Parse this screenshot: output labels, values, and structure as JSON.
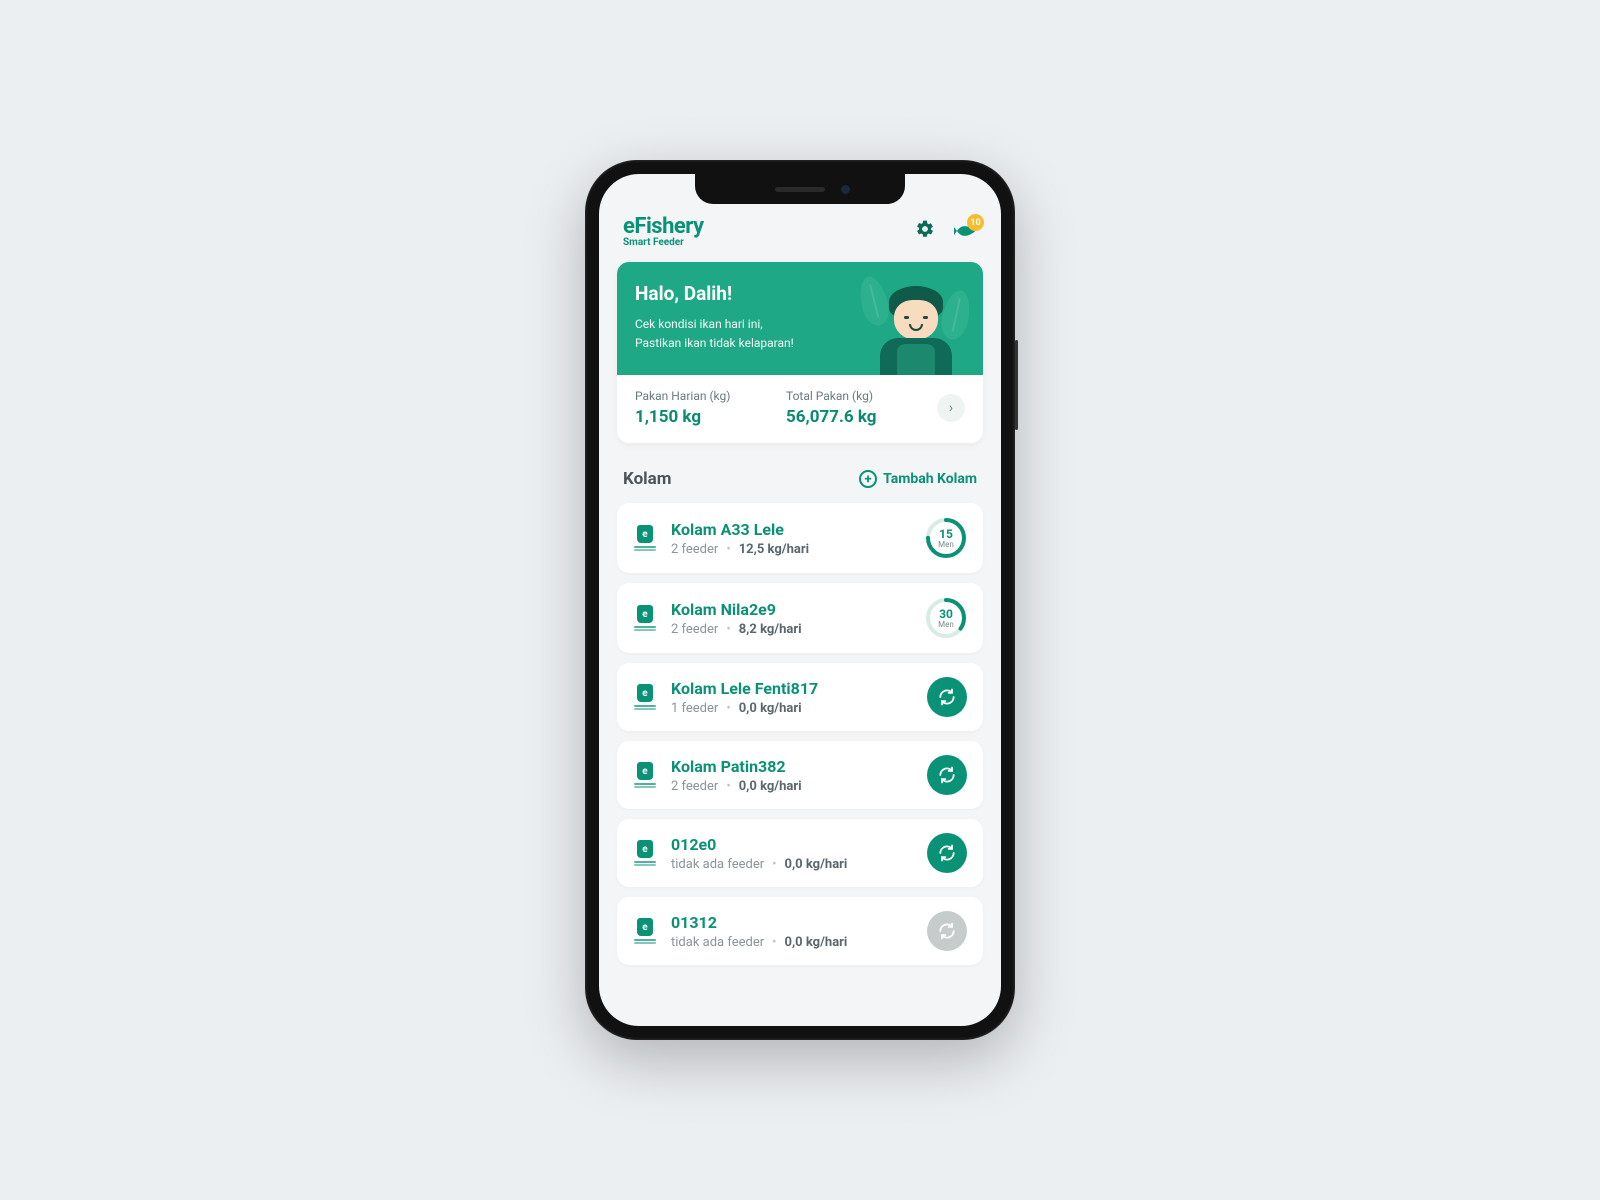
{
  "brand": {
    "name": "eFishery",
    "subtitle": "Smart Feeder"
  },
  "notifications": {
    "count": "10"
  },
  "hero": {
    "greeting": "Halo, Dalih!",
    "line1": "Cek kondisi ikan hari ini,",
    "line2": "Pastikan ikan tidak kelaparan!"
  },
  "stats": {
    "daily_label": "Pakan Harian (kg)",
    "daily_value": "1,150 kg",
    "total_label": "Total Pakan (kg)",
    "total_value": "56,077.6 kg"
  },
  "section": {
    "title": "Kolam",
    "add_label": "Tambah Kolam"
  },
  "ponds": [
    {
      "name": "Kolam A33 Lele",
      "feeder": "2 feeder",
      "rate": "12,5 kg/hari",
      "timer_value": "15",
      "timer_unit": "Men",
      "timer_pct": 75,
      "status": "timer"
    },
    {
      "name": "Kolam Nila2e9",
      "feeder": "2 feeder",
      "rate": "8,2 kg/hari",
      "timer_value": "30",
      "timer_unit": "Men",
      "timer_pct": 35,
      "status": "timer"
    },
    {
      "name": "Kolam Lele Fenti817",
      "feeder": "1 feeder",
      "rate": "0,0 kg/hari",
      "status": "sync"
    },
    {
      "name": "Kolam Patin382",
      "feeder": "2 feeder",
      "rate": "0,0 kg/hari",
      "status": "sync"
    },
    {
      "name": "012e0",
      "feeder": "tidak ada feeder",
      "rate": "0,0 kg/hari",
      "status": "sync"
    },
    {
      "name": "01312",
      "feeder": "tidak ada feeder",
      "rate": "0,0 kg/hari",
      "status": "disabled"
    }
  ],
  "colors": {
    "primary": "#0a9276",
    "accent": "#f9bc2e"
  }
}
